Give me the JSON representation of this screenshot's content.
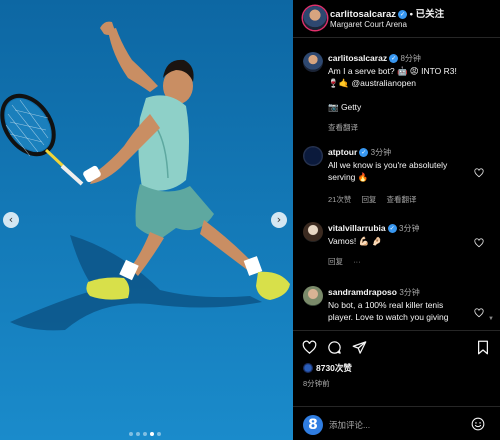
{
  "post": {
    "username": "carlitosalcaraz",
    "follow_status": "已关注",
    "separator": "•",
    "location": "Margaret Court Arena",
    "image_dots": 5,
    "active_dot": 3
  },
  "comments": [
    {
      "username": "carlitosalcaraz",
      "time": "8分钟",
      "lines": [
        "Am I a serve bot? 🤖 😡 INTO R3!",
        "🍷🤙 @australianopen",
        "",
        "📷 Getty"
      ],
      "meta": [
        "查看翻译"
      ]
    },
    {
      "username": "atptour",
      "time": "3分钟",
      "lines": [
        "All we know is you're absolutely",
        "serving 🔥"
      ],
      "meta": [
        "21次赞",
        "回复",
        "查看翻译"
      ]
    },
    {
      "username": "vitalvillarrubia",
      "time": "3分钟",
      "lines": [
        "Vamos! 💪🏻 🤌🏻"
      ],
      "meta": [
        "回复",
        "···"
      ]
    },
    {
      "username": "sandramdraposo",
      "time": "3分钟",
      "lines": [
        "No bot, a 100% real killer tenis",
        "player. Love to watch you giving"
      ],
      "meta": []
    }
  ],
  "likes": {
    "count": "8730次赞"
  },
  "post_age": "8分钟前",
  "composer": {
    "placeholder": "添加评论...",
    "user_initial": "8"
  },
  "colors": {
    "verified": "#3897f0",
    "court": "#1581c0",
    "shirt": "#8ed0c8",
    "shoes": "#d8e04a"
  }
}
